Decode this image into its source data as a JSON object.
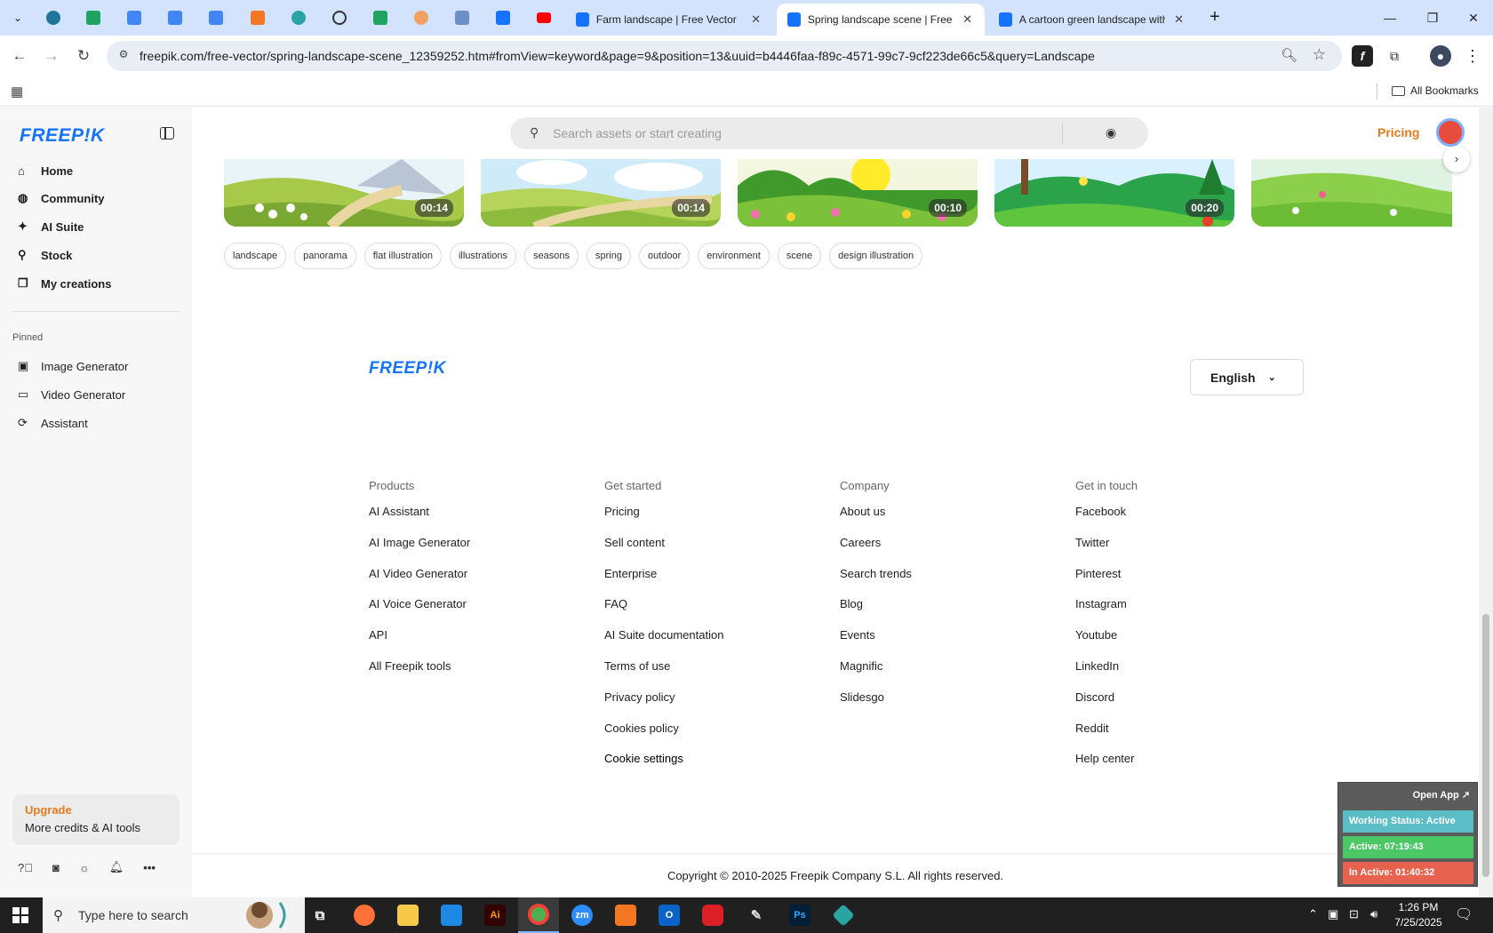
{
  "browser": {
    "tabs": [
      {
        "title": "Farm landscape | Free Vector",
        "active": false
      },
      {
        "title": "Spring landscape scene | Free V",
        "active": true
      },
      {
        "title": "A cartoon green landscape with",
        "active": false
      }
    ],
    "url": "freepik.com/free-vector/spring-landscape-scene_12359252.htm#fromView=keyword&page=9&position=13&uuid=b4446faa-f89c-4571-99c7-9cf223de66c5&query=Landscape",
    "all_bookmarks": "All Bookmarks"
  },
  "sidebar": {
    "logo": "FREEP!K",
    "nav": [
      {
        "label": "Home",
        "icon": "home-icon"
      },
      {
        "label": "Community",
        "icon": "globe-icon"
      },
      {
        "label": "AI Suite",
        "icon": "sparkle-icon"
      },
      {
        "label": "Stock",
        "icon": "search-icon"
      },
      {
        "label": "My creations",
        "icon": "stack-icon"
      }
    ],
    "pinned_label": "Pinned",
    "pinned": [
      {
        "label": "Image Generator",
        "icon": "image-icon"
      },
      {
        "label": "Video Generator",
        "icon": "video-icon"
      },
      {
        "label": "Assistant",
        "icon": "assistant-icon"
      }
    ],
    "upgrade": {
      "title": "Upgrade",
      "subtitle": "More credits & AI tools"
    }
  },
  "header": {
    "search_placeholder": "Search assets or start creating",
    "pricing": "Pricing"
  },
  "thumbnails": [
    {
      "duration": "00:14"
    },
    {
      "duration": "00:14"
    },
    {
      "duration": "00:10"
    },
    {
      "duration": "00:20"
    },
    {
      "duration": "0"
    }
  ],
  "tags": [
    "landscape",
    "panorama",
    "flat illustration",
    "illustrations",
    "seasons",
    "spring",
    "outdoor",
    "environment",
    "scene",
    "design illustration"
  ],
  "footer": {
    "logo": "FREEP!K",
    "language": "English",
    "columns": [
      {
        "heading": "Products",
        "links": [
          "AI Assistant",
          "AI Image Generator",
          "AI Video Generator",
          "AI Voice Generator",
          "API",
          "All Freepik tools"
        ]
      },
      {
        "heading": "Get started",
        "links": [
          "Pricing",
          "Sell content",
          "Enterprise",
          "FAQ",
          "AI Suite documentation",
          "Terms of use",
          "Privacy policy",
          "Cookies policy",
          "Cookie settings"
        ]
      },
      {
        "heading": "Company",
        "links": [
          "About us",
          "Careers",
          "Search trends",
          "Blog",
          "Events",
          "Magnific",
          "Slidesgo"
        ]
      },
      {
        "heading": "Get in touch",
        "links": [
          "Facebook",
          "Twitter",
          "Pinterest",
          "Instagram",
          "Youtube",
          "LinkedIn",
          "Discord",
          "Reddit",
          "Help center"
        ]
      }
    ],
    "copyright": "Copyright © 2010-2025 Freepik Company S.L. All rights reserved."
  },
  "widget": {
    "open_app": "Open App ↗",
    "status": "Working Status: Active",
    "active": "Active: 07:19:43",
    "inactive": "In Active: 01:40:32"
  },
  "taskbar": {
    "search_text": "Type here to search",
    "time": "1:26 PM",
    "date": "7/25/2025"
  },
  "colors": {
    "brand_blue": "#1673ff",
    "accent_orange": "#e07b21",
    "tab_strip": "#d3e3fd"
  }
}
